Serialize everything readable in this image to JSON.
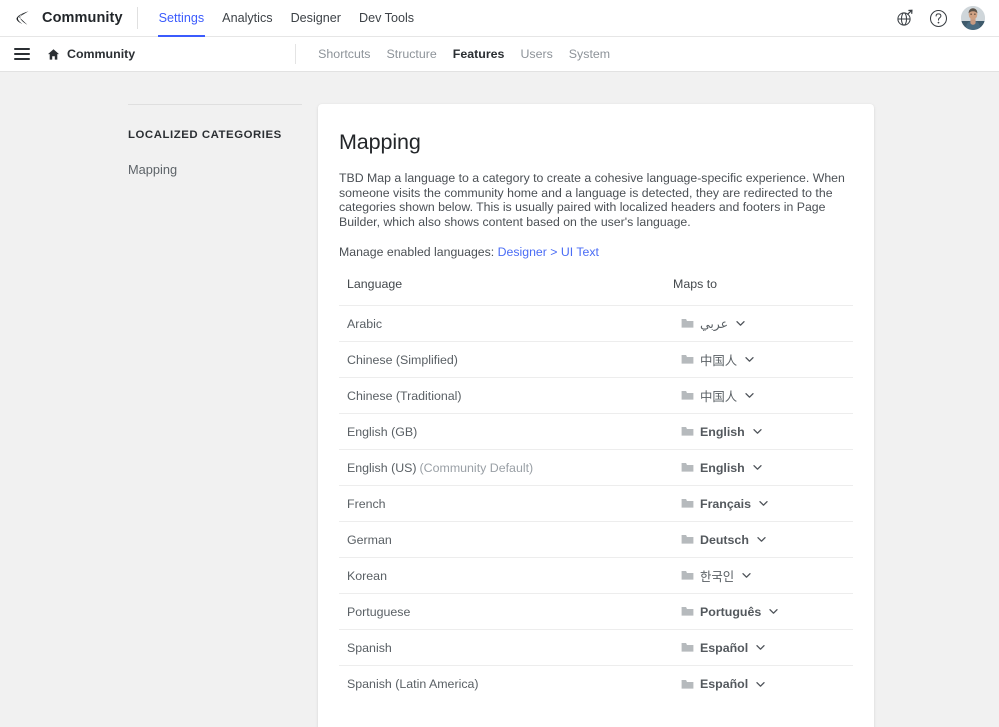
{
  "topbar": {
    "logo_icon": "khoros-logo-icon",
    "brand": "Community",
    "tabs": [
      {
        "label": "Settings",
        "active": true
      },
      {
        "label": "Analytics",
        "active": false
      },
      {
        "label": "Designer",
        "active": false
      },
      {
        "label": "Dev Tools",
        "active": false
      }
    ],
    "actions": [
      {
        "icon": "globe-external-link-icon"
      },
      {
        "icon": "help-circle-icon"
      },
      {
        "icon": "user-avatar"
      }
    ],
    "accent_color": "#3b5bfd"
  },
  "subbar": {
    "menu_icon": "hamburger-menu-icon",
    "home_icon": "home-icon",
    "home_label": "Community",
    "tabs": [
      {
        "label": "Shortcuts",
        "active": false
      },
      {
        "label": "Structure",
        "active": false
      },
      {
        "label": "Features",
        "active": true
      },
      {
        "label": "Users",
        "active": false
      },
      {
        "label": "System",
        "active": false
      }
    ]
  },
  "sidebar": {
    "heading": "LOCALIZED CATEGORIES",
    "items": [
      {
        "label": "Mapping",
        "active": false
      }
    ]
  },
  "main": {
    "title": "Mapping",
    "description": "TBD Map a language to a category to create a cohesive language-specific experience. When someone visits the community home and a language is detected, they are redirected to the categories shown below. This is usually paired with localized headers and footers in Page Builder, which also shows content based on the user's language.",
    "manage_prefix": "Manage enabled languages:",
    "manage_link": "Designer > UI Text",
    "link_color": "#4a6cf5",
    "table": {
      "columns": [
        "Language",
        "Maps to"
      ],
      "rows": [
        {
          "language": "Arabic",
          "note": "",
          "maps_to": "عربي",
          "folder_icon": "folder-icon",
          "chevron_icon": "chevron-down-icon",
          "script": "rtl"
        },
        {
          "language": "Chinese (Simplified)",
          "note": "",
          "maps_to": "中国人",
          "folder_icon": "folder-icon",
          "chevron_icon": "chevron-down-icon",
          "script": "cjk"
        },
        {
          "language": "Chinese (Traditional)",
          "note": "",
          "maps_to": "中国人",
          "folder_icon": "folder-icon",
          "chevron_icon": "chevron-down-icon",
          "script": "cjk"
        },
        {
          "language": "English (GB)",
          "note": "",
          "maps_to": "English",
          "folder_icon": "folder-icon",
          "chevron_icon": "chevron-down-icon",
          "script": "latin"
        },
        {
          "language": "English (US)",
          "note": "(Community Default)",
          "maps_to": "English",
          "folder_icon": "folder-icon",
          "chevron_icon": "chevron-down-icon",
          "script": "latin"
        },
        {
          "language": "French",
          "note": "",
          "maps_to": "Français",
          "folder_icon": "folder-icon",
          "chevron_icon": "chevron-down-icon",
          "script": "latin"
        },
        {
          "language": "German",
          "note": "",
          "maps_to": "Deutsch",
          "folder_icon": "folder-icon",
          "chevron_icon": "chevron-down-icon",
          "script": "latin"
        },
        {
          "language": "Korean",
          "note": "",
          "maps_to": "한국인",
          "folder_icon": "folder-icon",
          "chevron_icon": "chevron-down-icon",
          "script": "cjk"
        },
        {
          "language": "Portuguese",
          "note": "",
          "maps_to": "Português",
          "folder_icon": "folder-icon",
          "chevron_icon": "chevron-down-icon",
          "script": "latin"
        },
        {
          "language": "Spanish",
          "note": "",
          "maps_to": "Español",
          "folder_icon": "folder-icon",
          "chevron_icon": "chevron-down-icon",
          "script": "latin"
        },
        {
          "language": "Spanish (Latin America)",
          "note": "",
          "maps_to": "Español",
          "folder_icon": "folder-icon",
          "chevron_icon": "chevron-down-icon",
          "script": "latin"
        }
      ]
    }
  }
}
